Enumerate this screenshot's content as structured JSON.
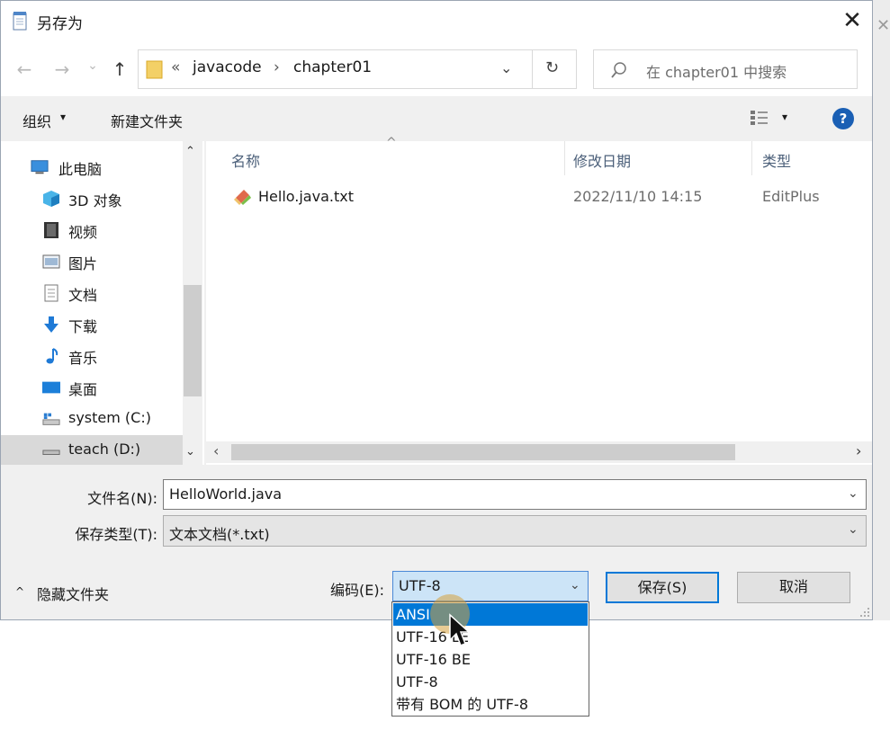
{
  "dialog": {
    "title": "另存为",
    "close_glyph": "✕"
  },
  "nav": {
    "back_glyph": "←",
    "forward_glyph": "→",
    "recent_glyph": "⌄",
    "up_glyph": "↑"
  },
  "address": {
    "overflow_glyph": "«",
    "segments": [
      "javacode",
      "chapter01"
    ],
    "separator_glyph": "›",
    "dropdown_glyph": "⌄",
    "refresh_glyph": "↻"
  },
  "search": {
    "placeholder": "在 chapter01 中搜索"
  },
  "toolbar": {
    "organize_label": "组织",
    "organize_arrow": "▾",
    "new_folder_label": "新建文件夹",
    "view_arrow": "▾",
    "help_label": "?"
  },
  "sidebar": {
    "up_arrow": "⌃",
    "down_arrow": "⌄",
    "items": [
      {
        "label": "此电脑",
        "icon": "computer-icon"
      },
      {
        "label": "3D 对象",
        "icon": "cube-3d-icon"
      },
      {
        "label": "视频",
        "icon": "video-icon"
      },
      {
        "label": "图片",
        "icon": "picture-icon"
      },
      {
        "label": "文档",
        "icon": "document-icon"
      },
      {
        "label": "下载",
        "icon": "download-icon"
      },
      {
        "label": "音乐",
        "icon": "music-icon"
      },
      {
        "label": "桌面",
        "icon": "desktop-icon"
      },
      {
        "label": "system (C:)",
        "icon": "system-drive-icon"
      },
      {
        "label": "teach (D:)",
        "icon": "drive-icon"
      }
    ]
  },
  "files": {
    "sort_caret": "^",
    "columns": [
      "名称",
      "修改日期",
      "类型"
    ],
    "rows": [
      {
        "name": "Hello.java.txt",
        "date": "2022/11/10 14:15",
        "type": "EditPlus",
        "icon": "editplus-file-icon"
      }
    ],
    "scroll_left": "‹",
    "scroll_right": "›"
  },
  "form": {
    "filename_label": "文件名(N):",
    "filename_value": "HelloWorld.java",
    "filetype_label": "保存类型(T):",
    "filetype_value": "文本文档(*.txt)",
    "combo_arrow": "⌄"
  },
  "footer": {
    "hide_folders_caret": "^",
    "hide_folders_label": "隐藏文件夹",
    "encoding_label": "编码(E):",
    "encoding_value": "UTF-8",
    "encoding_arrow": "⌄",
    "save_label": "保存(S)",
    "cancel_label": "取消"
  },
  "encoding_dropdown": {
    "options": [
      "ANSI",
      "UTF-16 LE",
      "UTF-16 BE",
      "UTF-8",
      "带有 BOM 的 UTF-8"
    ],
    "selected_index": 0
  },
  "background": {
    "close_glyph": "✕"
  }
}
